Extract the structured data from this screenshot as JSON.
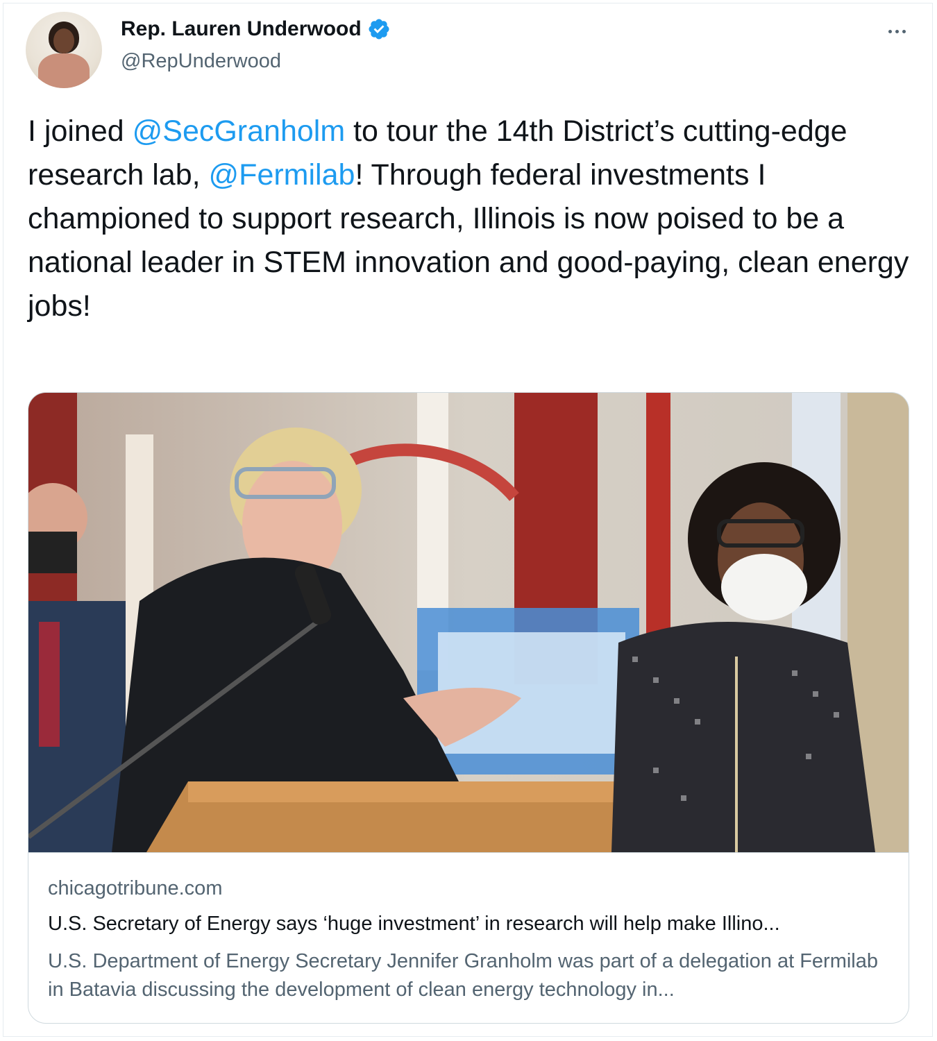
{
  "author": {
    "name": "Rep. Lauren Underwood",
    "handle": "@RepUnderwood",
    "verified_icon": "verified-badge-icon",
    "avatar_icon": "profile-avatar"
  },
  "more_menu_icon": "more-options-icon",
  "tweet": {
    "t1": "I joined ",
    "m1": "@SecGranholm",
    "t2": " to tour the 14th District’s cutting-edge research lab, ",
    "m2": "@Fermilab",
    "t3": "! Through federal investments I championed to support research, Illinois is now poised to be a national leader in STEM innovation and good-paying, clean energy jobs!"
  },
  "card": {
    "domain": "chicagotribune.com",
    "headline": "U.S. Secretary of Energy says ‘huge investment’ in research will help make Illino...",
    "description": "U.S. Department of Energy Secretary Jennifer Granholm was part of a delegation at Fermilab in Batavia discussing the development of clean energy technology in..."
  },
  "colors": {
    "link": "#1d9bf0",
    "text": "#0f1419",
    "secondary": "#536471",
    "border": "#cfd9de"
  }
}
